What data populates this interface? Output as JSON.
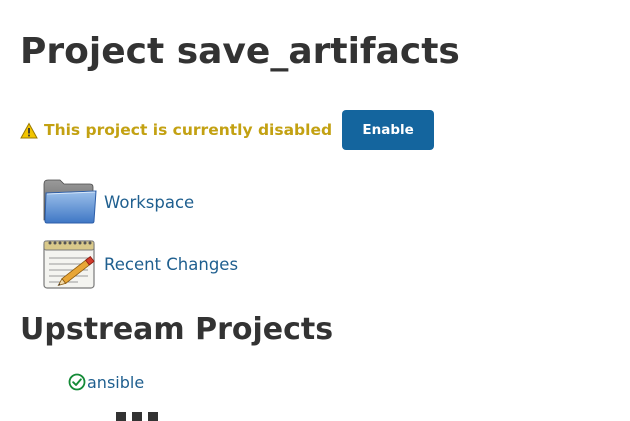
{
  "page": {
    "title": "Project save_artifacts"
  },
  "status": {
    "warning_text": "This project is currently disabled",
    "enable_label": "Enable",
    "warning_color": "#c3a112",
    "button_color": "#14659e"
  },
  "tasks": [
    {
      "label": "Workspace",
      "icon": "folder-icon"
    },
    {
      "label": "Recent Changes",
      "icon": "notepad-icon"
    }
  ],
  "upstream": {
    "heading": "Upstream Projects",
    "projects": [
      {
        "name": "ansible",
        "status": "success",
        "icon": "check-circle-icon",
        "color": "#138a36"
      }
    ]
  }
}
